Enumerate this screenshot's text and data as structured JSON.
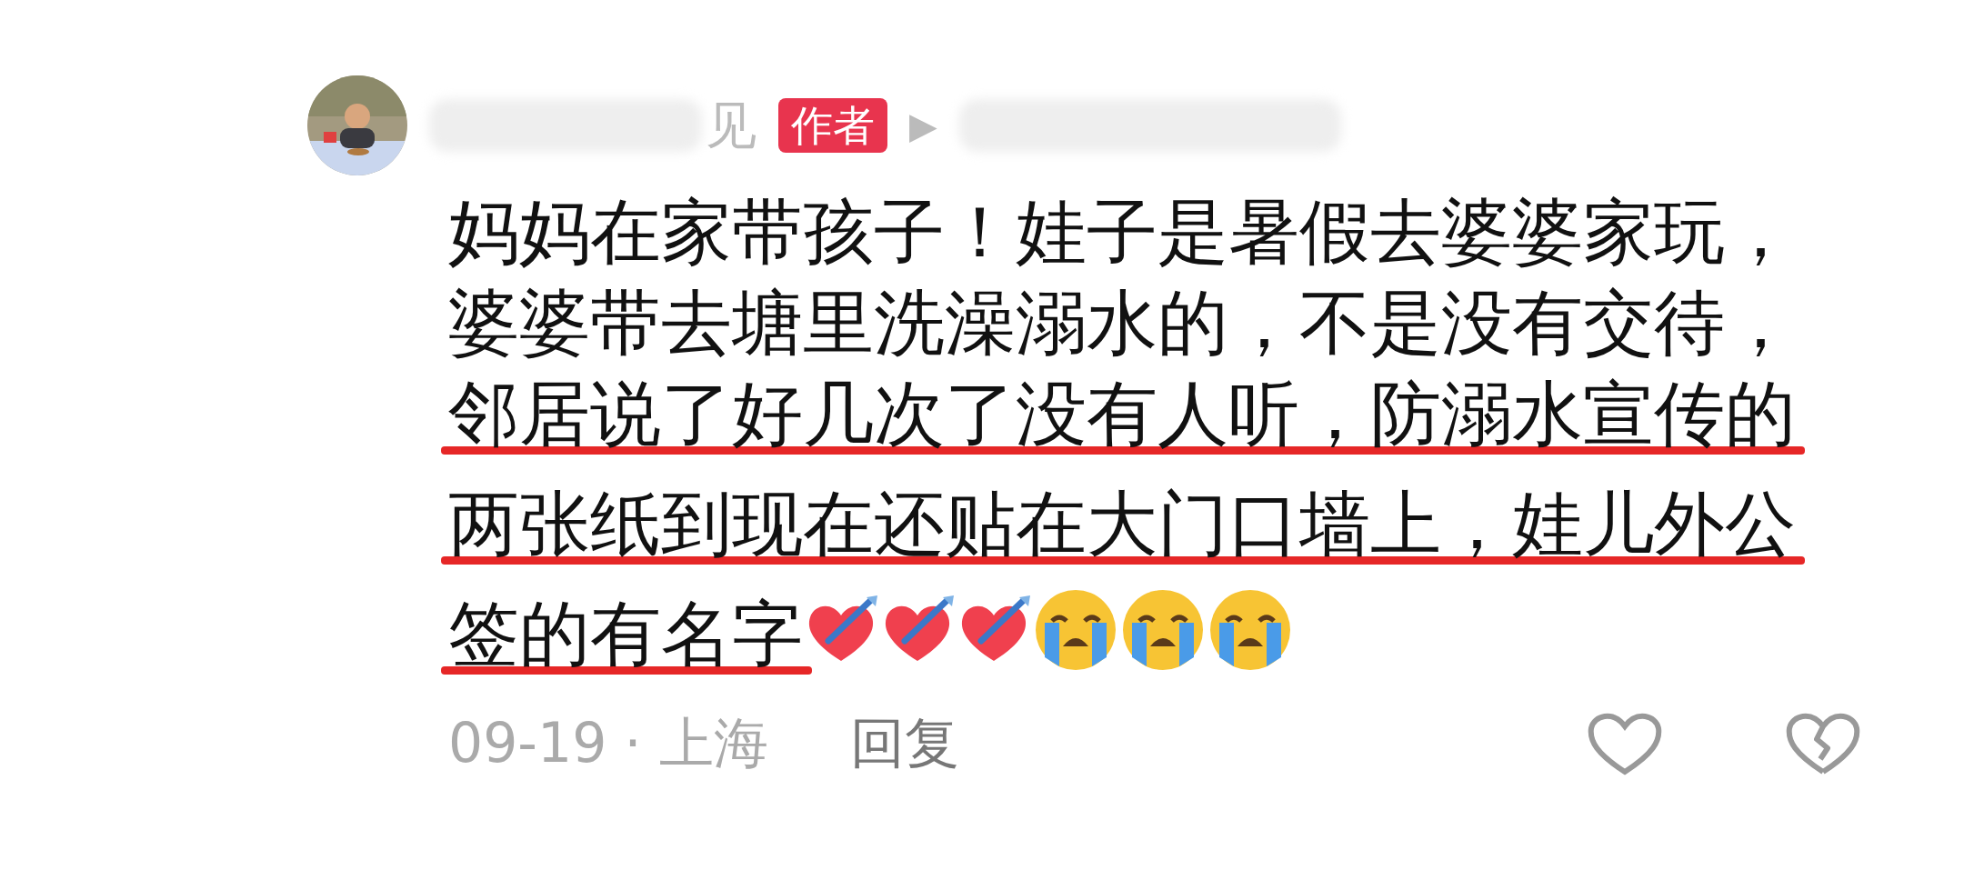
{
  "comment": {
    "author": {
      "name_visible": "见",
      "badge": "作者",
      "reply_arrow": "▶"
    },
    "lines": [
      {
        "text": "妈妈在家带孩子！娃子是暑假去婆婆家玩，",
        "underlined": false
      },
      {
        "text": "婆婆带去塘里洗澡溺水的，不是没有交待，",
        "underlined": false
      },
      {
        "text": "邻居说了好几次了没有人听，防溺水宣传的",
        "underlined": true
      },
      {
        "text": "两张纸到现在还贴在大门口墙上，娃儿外公",
        "underlined": true
      },
      {
        "text": "签的有名字",
        "underlined": true
      }
    ],
    "emojis": [
      {
        "kind": "heart-arrow"
      },
      {
        "kind": "heart-arrow"
      },
      {
        "kind": "heart-arrow"
      },
      {
        "kind": "crying"
      },
      {
        "kind": "crying"
      },
      {
        "kind": "crying"
      }
    ],
    "meta": "09-19 · 上海",
    "reply": "回复"
  }
}
